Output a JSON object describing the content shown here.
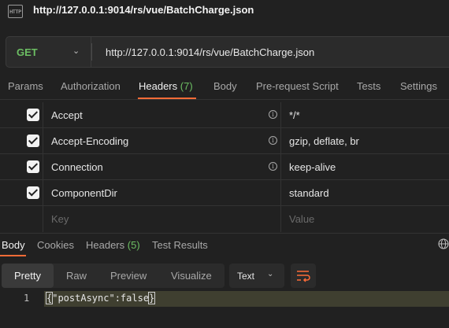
{
  "title_bar": {
    "icon_text": "HTTP",
    "title": "http://127.0.0.1:9014/rs/vue/BatchCharge.json"
  },
  "request": {
    "method": "GET",
    "url": "http://127.0.0.1:9014/rs/vue/BatchCharge.json"
  },
  "request_tabs": [
    {
      "label": "Params"
    },
    {
      "label": "Authorization"
    },
    {
      "label": "Headers",
      "count": "(7)",
      "active": true
    },
    {
      "label": "Body"
    },
    {
      "label": "Pre-request Script"
    },
    {
      "label": "Tests"
    },
    {
      "label": "Settings"
    }
  ],
  "headers_table": {
    "rows": [
      {
        "key": "Accept",
        "value": "*/*",
        "checked": true,
        "info": true
      },
      {
        "key": "Accept-Encoding",
        "value": "gzip, deflate, br",
        "checked": true,
        "info": true
      },
      {
        "key": "Connection",
        "value": "keep-alive",
        "checked": true,
        "info": true
      },
      {
        "key": "ComponentDir",
        "value": "standard",
        "checked": true,
        "info": false
      }
    ],
    "placeholder_key": "Key",
    "placeholder_value": "Value"
  },
  "response_tabs": [
    {
      "label": "Body",
      "active": true
    },
    {
      "label": "Cookies"
    },
    {
      "label": "Headers",
      "count": "(5)"
    },
    {
      "label": "Test Results"
    }
  ],
  "view_modes": [
    "Pretty",
    "Raw",
    "Preview",
    "Visualize"
  ],
  "active_view_mode": "Pretty",
  "format_select": {
    "value": "Text"
  },
  "response_body": {
    "line_number": "1",
    "open_brace": "{",
    "content": "\"postAsync\":false",
    "close_brace": "}"
  },
  "colors": {
    "accent": "#ff6c37",
    "method_get": "#6cbe63",
    "background": "#212121"
  }
}
